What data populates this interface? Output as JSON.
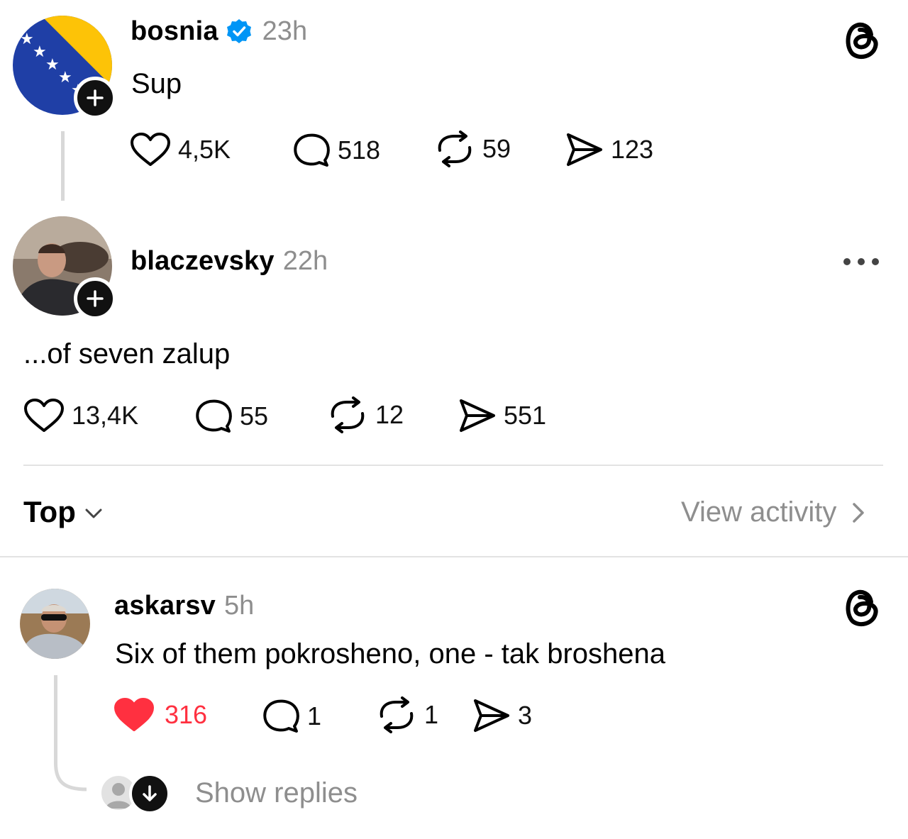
{
  "posts": [
    {
      "username": "bosnia",
      "verified": true,
      "time": "23h",
      "text": "Sup",
      "likes": "4,5K",
      "replies": "518",
      "reposts": "59",
      "shares": "123"
    },
    {
      "username": "blaczevsky",
      "time": "22h",
      "text": "...of seven zalup",
      "likes": "13,4K",
      "replies": "55",
      "reposts": "12",
      "shares": "551"
    }
  ],
  "sort": {
    "label": "Top"
  },
  "view_activity": "View activity",
  "reply": {
    "username": "askarsv",
    "time": "5h",
    "text": "Six of them pokrosheno, one - tak broshena",
    "likes": "316",
    "liked": true,
    "replies": "1",
    "reposts": "1",
    "shares": "3"
  },
  "show_replies": "Show replies",
  "colors": {
    "like_active": "#ff3040",
    "verified": "#0095f6",
    "muted": "#8e8e8e",
    "flag_blue": "#1f3fa6",
    "flag_yellow": "#fdc307"
  },
  "icons": [
    "threads-logo-icon",
    "verified-badge-icon",
    "heart-icon",
    "comment-icon",
    "repost-icon",
    "share-icon",
    "more-icon",
    "chevron-down-icon",
    "chevron-right-icon",
    "plus-icon",
    "arrow-down-icon"
  ]
}
